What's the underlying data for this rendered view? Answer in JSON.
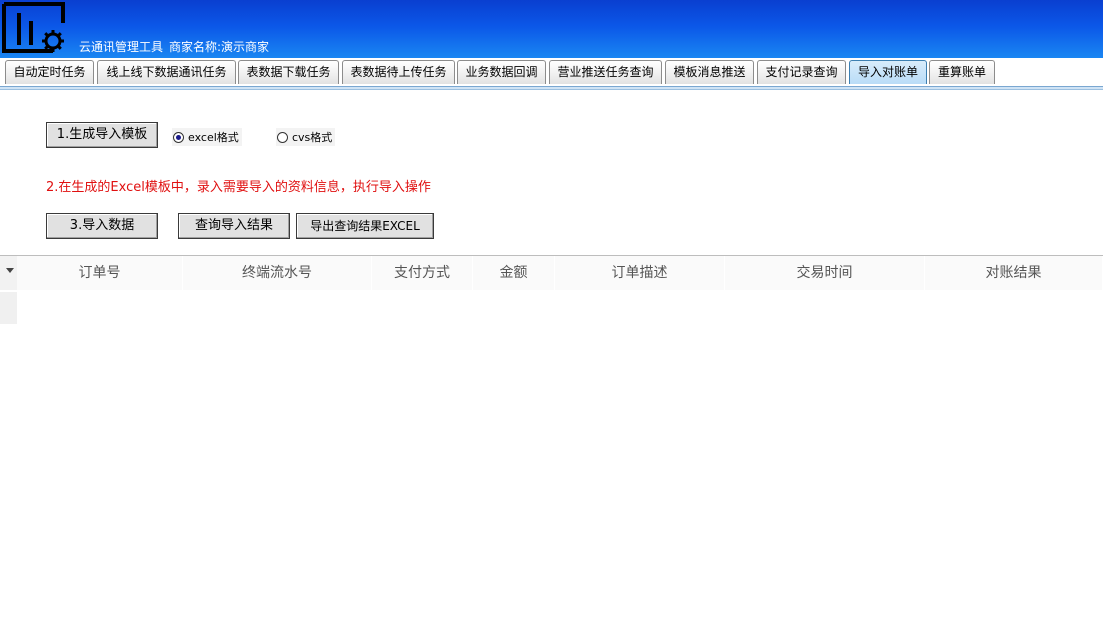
{
  "header": {
    "app_name": "云通讯管理工具",
    "merchant": "商家名称:演示商家",
    "logo_icon": "chart-gear-logo-icon"
  },
  "tabs": [
    {
      "label": "自动定时任务",
      "active": false
    },
    {
      "label": "线上线下数据通讯任务",
      "active": false
    },
    {
      "label": "表数据下载任务",
      "active": false
    },
    {
      "label": "表数据待上传任务",
      "active": false
    },
    {
      "label": "业务数据回调",
      "active": false
    },
    {
      "label": "营业推送任务查询",
      "active": false
    },
    {
      "label": "模板消息推送",
      "active": false
    },
    {
      "label": "支付记录查询",
      "active": false
    },
    {
      "label": "导入对账单",
      "active": true
    },
    {
      "label": "重算账单",
      "active": false
    }
  ],
  "step1": {
    "button_label": "1.生成导入模板",
    "format_options": [
      {
        "label": "excel格式",
        "checked": true
      },
      {
        "label": "cvs格式",
        "checked": false
      }
    ]
  },
  "step2": {
    "instruction": "2.在生成的Excel模板中，录入需要导入的资料信息，执行导入操作"
  },
  "step3": {
    "import_button": "3.导入数据",
    "query_button": "查询导入结果",
    "export_button": "导出查询结果EXCEL"
  },
  "table": {
    "columns": [
      "订单号",
      "终端流水号",
      "支付方式",
      "金额",
      "订单描述",
      "交易时间",
      "对账结果"
    ],
    "rows": []
  },
  "colors": {
    "header_gradient_top": "#0a3fd0",
    "header_gradient_bottom": "#1a86f2",
    "active_tab": "#b9dcf7",
    "instruction_text": "#e01010"
  }
}
